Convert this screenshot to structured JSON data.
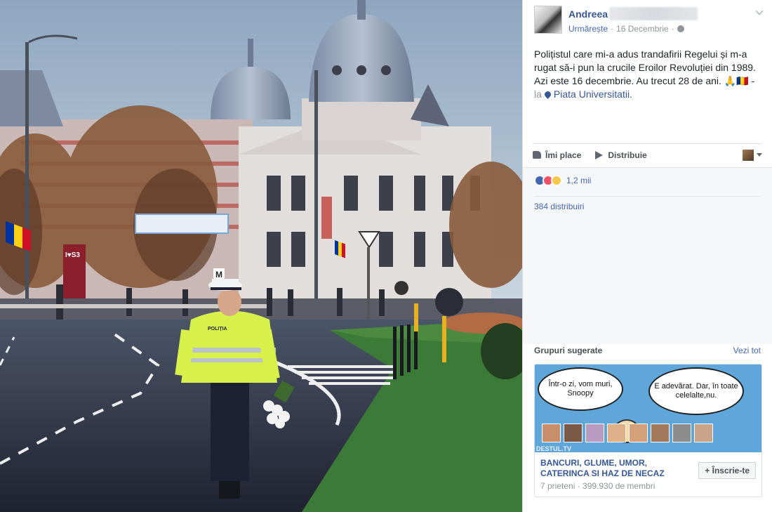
{
  "photo": {
    "sign_letter": "M",
    "cap_label": "POLIȚIA",
    "advert_label": "I♥S3"
  },
  "post": {
    "author": "Andreea",
    "follow": "Urmărește",
    "date": "16 Decembrie",
    "dot": "·",
    "text_line1": "Polițistul care mi-a adus trandafirii Regelui și m-a",
    "text_line2": "rugat să-i pun la crucile Eroilor Revoluției din 1989.",
    "text_line3": "Azi este 16 decembrie. Au trecut 28 de ani. 🙏🇷🇴 -",
    "location_prefix": "la",
    "location": "Piata Universitatii."
  },
  "actions": {
    "like": "Îmi place",
    "share": "Distribuie"
  },
  "stats": {
    "reactions_count": "1,2 mii",
    "shares": "384 distribuiri"
  },
  "suggested": {
    "title": "Grupuri sugerate",
    "see_all": "Vezi tot",
    "bubble_left": "Într-o zi, vom muri, Snoopy",
    "bubble_right": "E adevărat. Dar, în toate celelalte,nu.",
    "watermark": "DESTUL.TV",
    "group_name": "BANCURI, GLUME, UMOR, CATERINCA SI HAZ DE NECAZ",
    "group_meta": "7 prieteni · 399.930 de membri",
    "join": "+ Înscrie-te"
  },
  "colors": {
    "link": "#365899",
    "accent": "#4267b2",
    "muted": "#90949c"
  }
}
